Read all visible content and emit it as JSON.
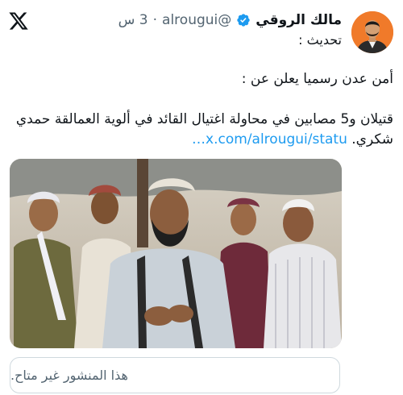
{
  "tweet": {
    "author_name": "مالك الروقي",
    "handle": "@alrougui",
    "separator": "·",
    "time": "3 س",
    "subtitle": "تحديث :",
    "paragraph1": "أمن عدن رسميا يعلن عن :",
    "paragraph2": "قتيلان و5 مصابين في محاولة اغتيال القائد في ألوية العمالقة حمدي شكري.",
    "link_text": "x.com/alrougui/statu…"
  },
  "unavailable_notice": "هذا المنشور غير متاح.",
  "icons": {
    "app_logo": "x-logo-icon",
    "verified": "verified-badge-icon"
  },
  "colors": {
    "link": "#1d9bf0",
    "verified": "#1d9bf0",
    "secondary_text": "#536471",
    "avatar_bg": "#f07a2a"
  }
}
